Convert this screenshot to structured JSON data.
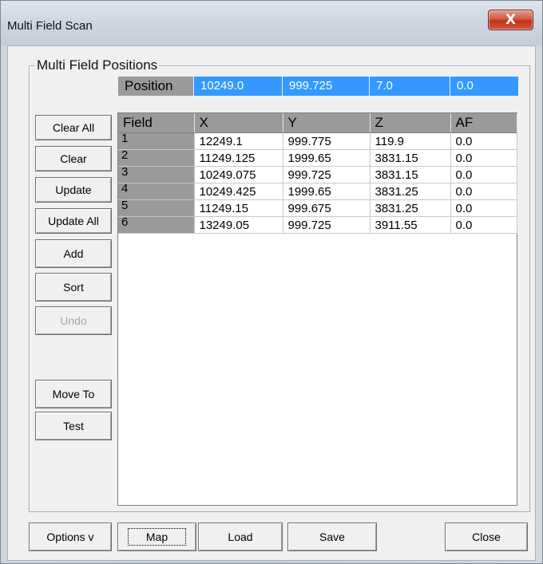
{
  "window": {
    "title": "Multi Field Scan",
    "close_glyph": "X"
  },
  "group": {
    "label": "Multi Field Positions"
  },
  "position": {
    "label": "Position",
    "values": [
      "10249.0",
      "999.725",
      "7.0",
      "0.0"
    ]
  },
  "side_buttons": {
    "clear_all": "Clear All",
    "clear": "Clear",
    "update": "Update",
    "update_all": "Update All",
    "add": "Add",
    "sort": "Sort",
    "undo": "Undo",
    "move_to": "Move To",
    "test": "Test"
  },
  "table": {
    "columns": [
      "Field",
      "X",
      "Y",
      "Z",
      "AF"
    ],
    "rows": [
      [
        "1",
        "12249.1",
        "999.775",
        "119.9",
        "0.0"
      ],
      [
        "2",
        "11249.125",
        "1999.65",
        "3831.15",
        "0.0"
      ],
      [
        "3",
        "10249.075",
        "999.725",
        "3831.15",
        "0.0"
      ],
      [
        "4",
        "10249.425",
        "1999.65",
        "3831.25",
        "0.0"
      ],
      [
        "5",
        "11249.15",
        "999.675",
        "3831.25",
        "0.0"
      ],
      [
        "6",
        "13249.05",
        "999.725",
        "3911.55",
        "0.0"
      ]
    ]
  },
  "bottom_buttons": {
    "options": "Options v",
    "map": "Map",
    "load": "Load",
    "save": "Save",
    "close": "Close"
  },
  "colors": {
    "selection": "#3399ff",
    "header_gray": "#9a9a9a",
    "close_red": "#c1321c"
  }
}
